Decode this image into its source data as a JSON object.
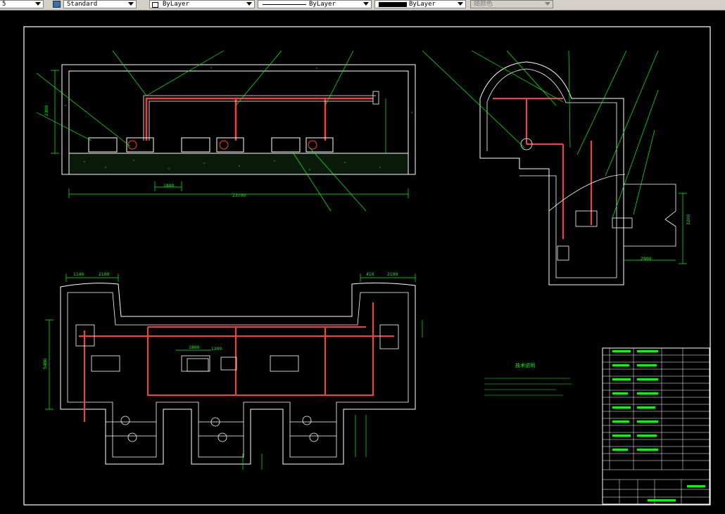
{
  "toolbar": {
    "layer_value": "5",
    "textstyle_value": "Standard",
    "color_value": "ByLayer",
    "linetype_value": "ByLayer",
    "lineweight_value": "ByLayer",
    "plotstyle_value": "随颜色"
  },
  "drawing": {
    "notes_title": "技术说明",
    "elevation_dims": [
      "2300",
      "1800",
      "23700"
    ],
    "plan_dims": [
      "1140",
      "2100",
      "410",
      "2100",
      "1800",
      "1200",
      "5400",
      "1000",
      "5000"
    ],
    "section_dims": [
      "3200",
      "2900",
      "5300",
      "3000",
      "2200"
    ]
  },
  "colors": {
    "background": "#000000",
    "wall": "#ffffff",
    "dimension": "#00ff00",
    "pipe": "#ff3c3c",
    "text": "#00ff00",
    "toolbar": "#d4d0c8"
  }
}
